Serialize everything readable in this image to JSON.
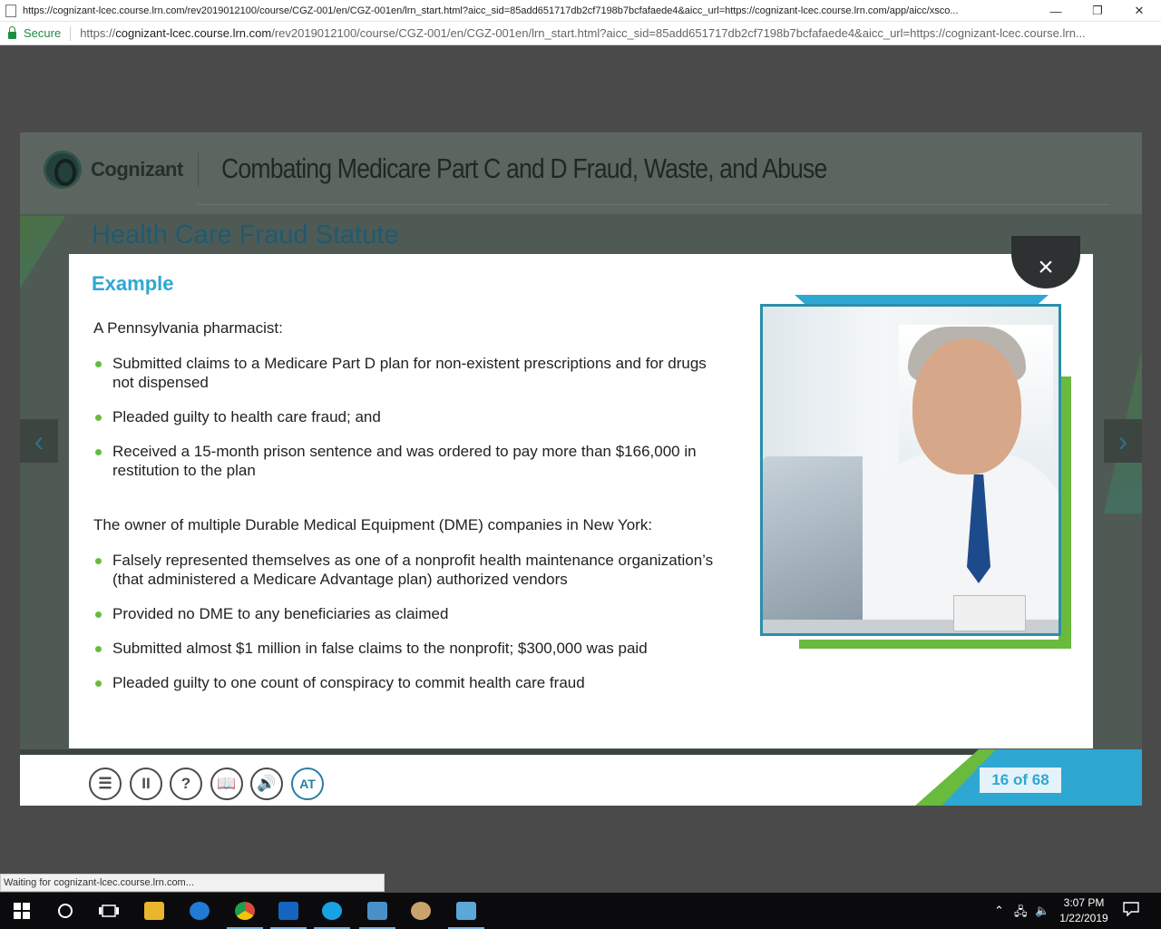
{
  "browser": {
    "title": "https://cognizant-lcec.course.lrn.com/rev2019012100/course/CGZ-001/en/CGZ-001en/lrn_start.html?aicc_sid=85add651717db2cf7198b7bcfafaede4&aicc_url=https://cognizant-lcec.course.lrn.com/app/aicc/xsco...",
    "secure_label": "Secure",
    "url_prefix": "https://",
    "url_host": "cognizant-lcec.course.lrn.com",
    "url_path": "/rev2019012100/course/CGZ-001/en/CGZ-001en/lrn_start.html?aicc_sid=85add651717db2cf7198b7bcfafaede4&aicc_url=https://cognizant-lcec.course.lrn...",
    "minimize_glyph": "—",
    "restore_glyph": "❐",
    "close_glyph": "✕"
  },
  "course": {
    "brand": "Cognizant",
    "title": "Combating Medicare Part C and D Fraud, Waste, and Abuse",
    "slide_heading": "Health Care Fraud Statute",
    "prev_glyph": "‹",
    "next_glyph": "›",
    "page_counter": "16 of 68",
    "toolbar": [
      {
        "name": "menu-button",
        "glyph": "☰"
      },
      {
        "name": "pause-button",
        "glyph": "II"
      },
      {
        "name": "help-button",
        "glyph": "?"
      },
      {
        "name": "glossary-button",
        "glyph": "📖"
      },
      {
        "name": "audio-button",
        "glyph": "🔊"
      },
      {
        "name": "text-settings-button",
        "glyph": "AT"
      }
    ]
  },
  "modal": {
    "close_glyph": "×",
    "heading": "Example",
    "case1_intro": "A Pennsylvania pharmacist:",
    "case1_items": [
      "Submitted claims to a Medicare Part D plan for non-existent prescriptions and for drugs not dispensed",
      "Pleaded guilty to health care fraud; and",
      "Received a 15-month prison sentence and was ordered to pay more than $166,000 in restitution to the plan"
    ],
    "case2_intro": "The owner of multiple Durable Medical Equipment (DME) companies in New York:",
    "case2_items": [
      "Falsely represented themselves as one of a nonprofit health maintenance organization’s (that administered a Medicare Advantage plan) authorized vendors",
      "Provided no DME to any beneficiaries as claimed",
      "Submitted almost $1 million in false claims to the nonprofit; $300,000 was paid",
      "Pleaded guilty to one count of conspiracy to commit health care fraud"
    ]
  },
  "status": {
    "text": "Waiting for cognizant-lcec.course.lrn.com..."
  },
  "taskbar": {
    "time": "3:07 PM",
    "date": "1/22/2019",
    "apps": [
      {
        "name": "file-explorer",
        "color": "#e8b52c"
      },
      {
        "name": "edge",
        "color": "#1f7bd6"
      },
      {
        "name": "chrome",
        "color": "#dd4a3c"
      },
      {
        "name": "outlook",
        "color": "#1565c0"
      },
      {
        "name": "skype",
        "color": "#19a2e3"
      },
      {
        "name": "remote-desktop",
        "color": "#4a90c8"
      },
      {
        "name": "paint",
        "color": "#c8a36a"
      },
      {
        "name": "notes-app",
        "color": "#5aa7d8"
      }
    ]
  }
}
